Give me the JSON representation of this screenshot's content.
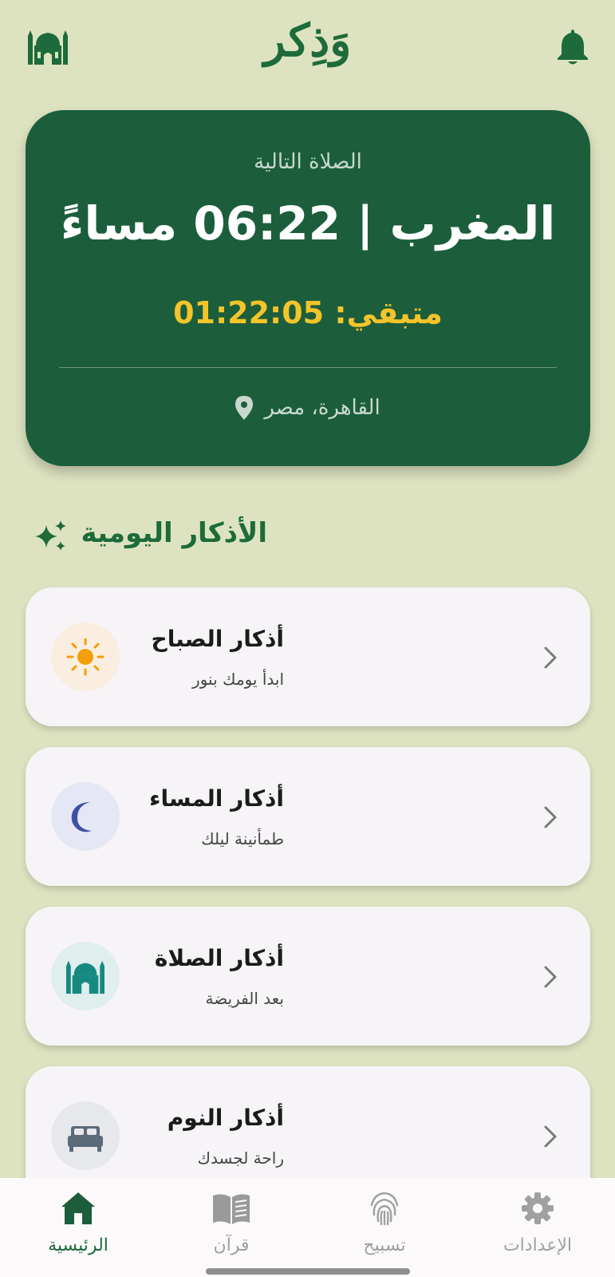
{
  "header": {
    "app_title": "وَذِكر",
    "left_icon": "mosque-icon",
    "right_icon": "bell-icon"
  },
  "prayer_card": {
    "label": "الصلاة التالية",
    "prayer_time": "المغرب | 06:22 مساءً",
    "remaining": "متبقي: 01:22:05",
    "location": "القاهرة، مصر",
    "location_icon": "map-pin-icon"
  },
  "daily_section": {
    "title": "الأذكار اليومية",
    "icon": "sparkle-icon"
  },
  "cards": [
    {
      "title": "أذكار الصباح",
      "subtitle": "ابدأ يومك بنور",
      "icon": "sun-icon",
      "icon_color": "#f59e0b",
      "icon_bg": "#faeee0"
    },
    {
      "title": "أذكار المساء",
      "subtitle": "طمأنينة ليلك",
      "icon": "moon-icon",
      "icon_color": "#3f4fa8",
      "icon_bg": "#e5e7f4"
    },
    {
      "title": "أذكار الصلاة",
      "subtitle": "بعد الفريضة",
      "icon": "mosque-icon",
      "icon_color": "#168a80",
      "icon_bg": "#e0eeee"
    },
    {
      "title": "أذكار النوم",
      "subtitle": "راحة لجسدك",
      "icon": "bed-icon",
      "icon_color": "#5b6a78",
      "icon_bg": "#e6e8ec"
    }
  ],
  "bottom_nav": {
    "items": [
      {
        "label": "الرئيسية",
        "icon": "home-icon",
        "active": true
      },
      {
        "label": "قرآن",
        "icon": "book-icon",
        "active": false
      },
      {
        "label": "تسبيح",
        "icon": "fingerprint-icon",
        "active": false
      },
      {
        "label": "الإعدادات",
        "icon": "gear-icon",
        "active": false
      }
    ]
  },
  "colors": {
    "background": "#dde3c0",
    "primary": "#1c5e3c",
    "accent": "#f4c42a"
  }
}
